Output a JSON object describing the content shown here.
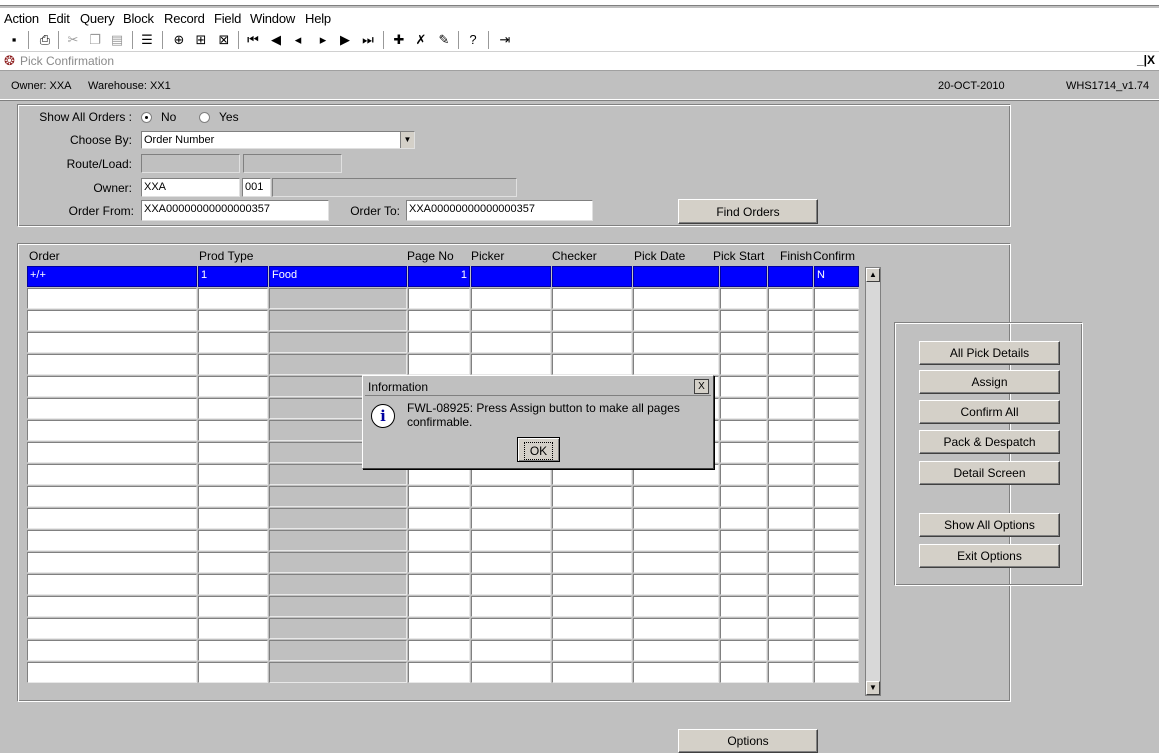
{
  "menu": [
    "Action",
    "Edit",
    "Query",
    "Block",
    "Record",
    "Field",
    "Window",
    "Help"
  ],
  "toolbar": {
    "icons": [
      "save-icon",
      "print-icon",
      "cut-icon",
      "copy-icon",
      "paste-icon",
      "list-icon",
      "insert-record-icon",
      "duplicate-record-icon",
      "clear-record-icon",
      "first-record-icon",
      "previous-set-icon",
      "previous-record-icon",
      "next-record-icon",
      "next-set-icon",
      "last-record-icon",
      "add-icon",
      "delete-icon",
      "clear-icon",
      "help-icon",
      "exit-icon"
    ]
  },
  "window": {
    "title": "Pick Confirmation",
    "controls": "_|X"
  },
  "info": {
    "owner": "Owner: XXA",
    "warehouse": "Warehouse: XX1",
    "date": "20-OCT-2010",
    "version": "WHS1714_v1.74"
  },
  "criteria": {
    "show_all_orders_label": "Show All Orders :",
    "no_label": "No",
    "yes_label": "Yes",
    "choose_by_label": "Choose By:",
    "choose_by_value": "Order Number",
    "route_load_label": "Route/Load:",
    "owner_label": "Owner:",
    "owner_value": "XXA",
    "owner_code": "001",
    "order_from_label": "Order From:",
    "order_from_value": "XXA00000000000000357",
    "order_to_label": "Order To:",
    "order_to_value": "XXA00000000000000357",
    "find_orders": "Find Orders"
  },
  "grid": {
    "headers": [
      "Order",
      "Prod Type",
      "Page No",
      "Picker",
      "Checker",
      "Pick Date",
      "Pick Start",
      "Finish",
      "Confirm"
    ],
    "first_row": {
      "order": "+/+",
      "prod_type": "1",
      "prod_desc": "Food",
      "page_no": "1",
      "confirm": "N"
    }
  },
  "side_buttons": [
    "All Pick Details",
    "Assign",
    "Confirm All",
    "Pack & Despatch",
    "Detail Screen",
    "Show All Options",
    "Exit Options"
  ],
  "options_button": "Options",
  "dialog": {
    "title": "Information",
    "message": "FWL-08925:  Press Assign button to make all pages confirmable.",
    "ok": "OK",
    "close": "X",
    "icon_letter": "i"
  }
}
